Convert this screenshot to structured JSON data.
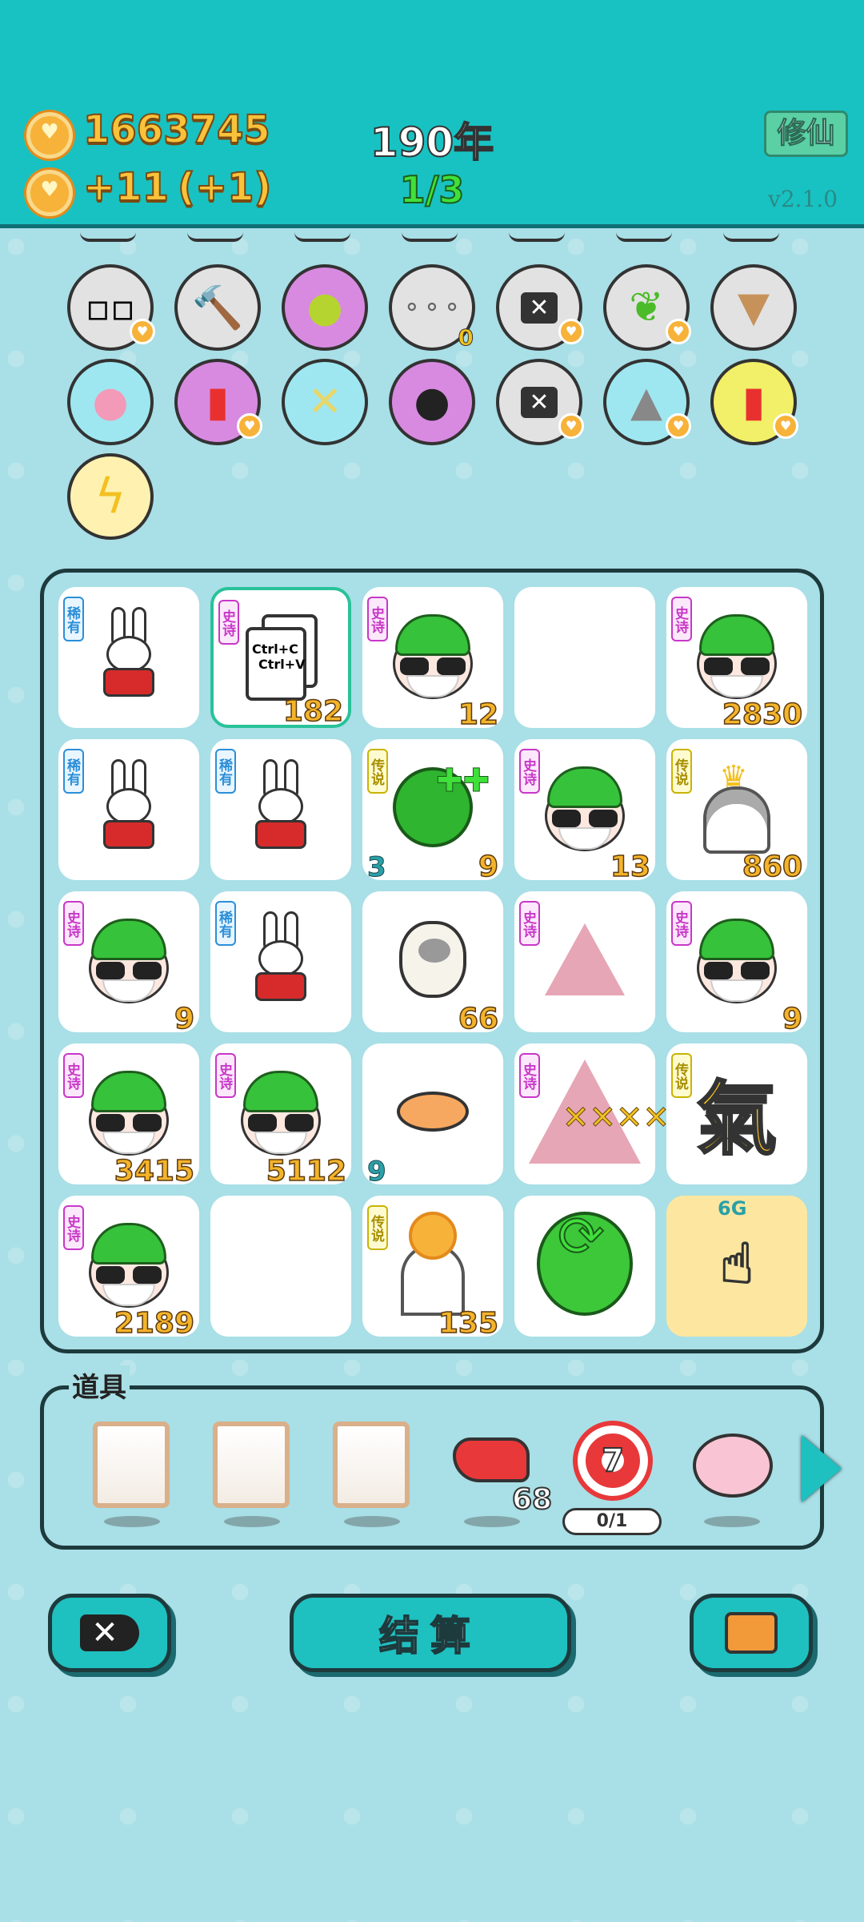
{
  "header": {
    "coins": "1663745",
    "income": "+11",
    "income_bonus": "(+1)",
    "year": "190年",
    "round": "1/3",
    "mode_button": "修仙",
    "version": "v2.1.0"
  },
  "icons_row1": [
    {
      "name": "sugar-cubes-icon",
      "badge": "heart"
    },
    {
      "name": "hammer-icon"
    },
    {
      "name": "pomelo-icon"
    },
    {
      "name": "egg-tray-icon",
      "count": "0"
    },
    {
      "name": "delete-tag-icon",
      "badge": "heart"
    },
    {
      "name": "leaf-icon",
      "badge": "heart"
    },
    {
      "name": "bubble-tea-icon"
    }
  ],
  "icons_row2": [
    {
      "name": "piggy-bank-icon"
    },
    {
      "name": "french-fries-icon",
      "badge": "heart"
    },
    {
      "name": "crossed-sticks-icon"
    },
    {
      "name": "panda-icon"
    },
    {
      "name": "delete-tag-icon",
      "badge": "heart"
    },
    {
      "name": "husky-dog-icon",
      "badge": "heart"
    },
    {
      "name": "french-fries-icon",
      "badge": "heart"
    }
  ],
  "icons_row3": [
    {
      "name": "lightning-icon"
    }
  ],
  "board": {
    "cells": [
      {
        "item": "rabbit",
        "tag": "稀有",
        "value": ""
      },
      {
        "item": "copy-paste",
        "tag": "史诗",
        "value": "182",
        "copy_line1": "Ctrl+C",
        "copy_line2": "Ctrl+V"
      },
      {
        "item": "face",
        "tag": "史诗",
        "value": "12"
      },
      {
        "item": "empty",
        "tag": "",
        "value": ""
      },
      {
        "item": "face",
        "tag": "史诗",
        "value": "2830"
      },
      {
        "item": "rabbit",
        "tag": "稀有",
        "value": ""
      },
      {
        "item": "rabbit",
        "tag": "稀有",
        "value": ""
      },
      {
        "item": "watermelon",
        "tag": "传说",
        "value": "9",
        "left": "3"
      },
      {
        "item": "face",
        "tag": "史诗",
        "value": "13"
      },
      {
        "item": "husky-king",
        "tag": "传说",
        "value": "860"
      },
      {
        "item": "face",
        "tag": "史诗",
        "value": "9"
      },
      {
        "item": "rabbit",
        "tag": "稀有",
        "value": ""
      },
      {
        "item": "sheep",
        "tag": "",
        "value": "66"
      },
      {
        "item": "rabbit-tent",
        "tag": "史诗",
        "value": ""
      },
      {
        "item": "face",
        "tag": "史诗",
        "value": "9"
      },
      {
        "item": "face",
        "tag": "史诗",
        "value": "3415"
      },
      {
        "item": "face",
        "tag": "史诗",
        "value": "5112"
      },
      {
        "item": "fish",
        "tag": "",
        "value": "",
        "left": "9"
      },
      {
        "item": "rabbit-tent-big",
        "tag": "史诗",
        "value": ""
      },
      {
        "item": "qi-character",
        "tag": "传说",
        "value": "",
        "glyph": "氣"
      },
      {
        "item": "face",
        "tag": "史诗",
        "value": "2189"
      },
      {
        "item": "empty",
        "tag": "",
        "value": ""
      },
      {
        "item": "husky-coin",
        "tag": "传说",
        "value": "135"
      },
      {
        "item": "refresh-ball",
        "tag": "",
        "value": ""
      },
      {
        "item": "hand-sign",
        "tag": "",
        "value": "",
        "label": "6G"
      }
    ]
  },
  "tools": {
    "title": "道具",
    "items": [
      {
        "name": "empty-slot-1"
      },
      {
        "name": "empty-slot-2"
      },
      {
        "name": "empty-slot-3"
      },
      {
        "name": "liver-icon",
        "count": "68"
      },
      {
        "name": "target-icon",
        "number": "7",
        "progress": "0/1"
      },
      {
        "name": "piggy-bank-icon"
      }
    ]
  },
  "bottom": {
    "settle_label": "结算"
  }
}
